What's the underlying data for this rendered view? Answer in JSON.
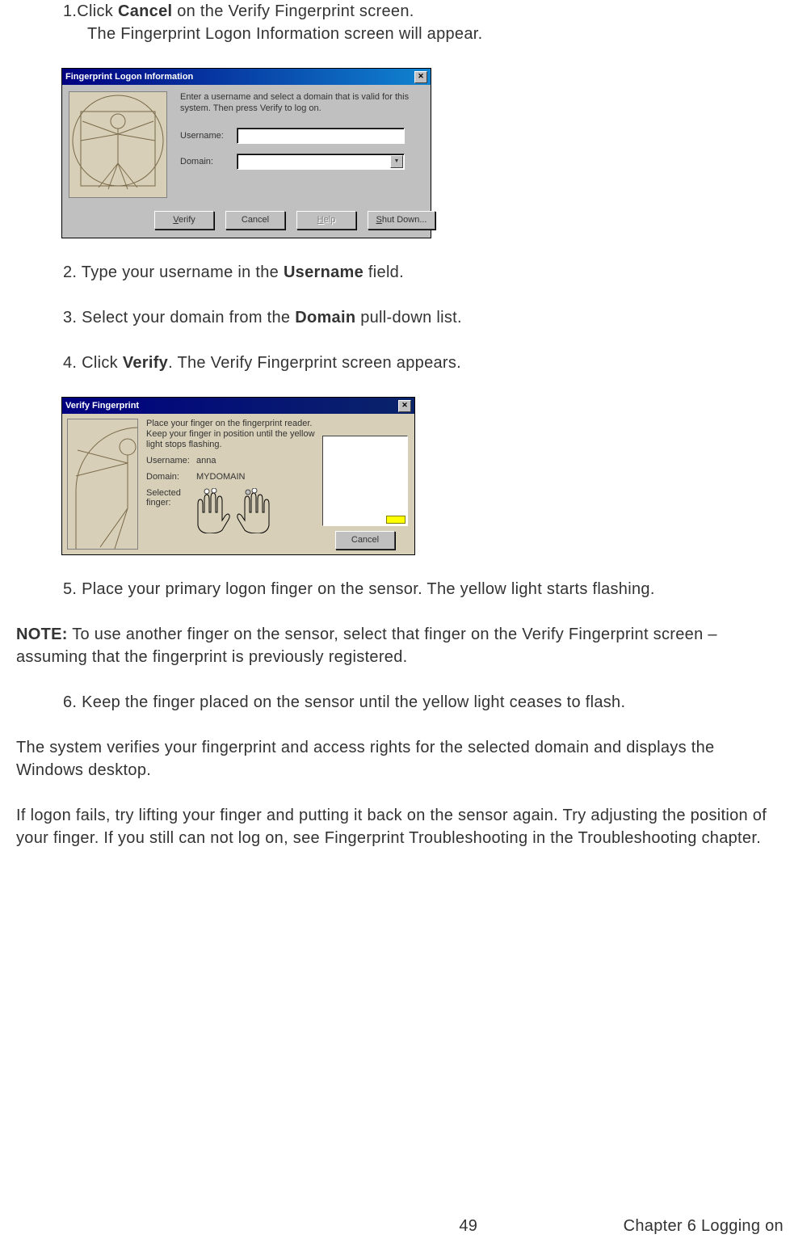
{
  "steps": {
    "s1_a": "1.",
    "s1_b": "Click ",
    "s1_c": "Cancel",
    "s1_d": " on the Verify Fingerprint screen.",
    "s1_e": "The Fingerprint Logon Information screen will appear.",
    "s2_a": "2. Type your username in the ",
    "s2_b": "Username",
    "s2_c": " field.",
    "s3_a": "3. Select your domain from the ",
    "s3_b": "Domain",
    "s3_c": " pull-down list.",
    "s4_a": "4. Click ",
    "s4_b": "Verify",
    "s4_c": ". The Verify Fingerprint screen appears.",
    "s5": "5. Place your primary logon finger on the sensor. The yellow light starts flashing.",
    "s6": "6. Keep the finger placed on the sensor until the yellow light ceases to flash."
  },
  "dlg1": {
    "title": "Fingerprint Logon Information",
    "instr": "Enter a username and select a domain that is valid for this system. Then press Verify to log on.",
    "username_label": "Username:",
    "domain_label": "Domain:",
    "verify_btn": "Verify",
    "verify_u": "V",
    "cancel_btn": "Cancel",
    "help_btn": "Help",
    "help_u": "H",
    "shutdown_a": "S",
    "shutdown_b": "hut Down..."
  },
  "dlg2": {
    "title": "Verify Fingerprint",
    "instr": "Place your finger on the fingerprint reader. Keep your finger in position until the yellow light stops flashing.",
    "username_label": "Username:",
    "username_val": "anna",
    "domain_label": "Domain:",
    "domain_val": "MYDOMAIN",
    "selected_label": "Selected finger:",
    "cancel_btn": "Cancel"
  },
  "note": {
    "label": "NOTE:",
    "text": " To use another finger on the sensor, select that finger on the Verify Fingerprint screen – assuming that the fingerprint is previously registered."
  },
  "para1": "The system verifies your fingerprint and access rights for the selected domain and displays the Windows desktop.",
  "para2": "If logon fails, try lifting your finger and putting it back on the sensor again. Try adjusting the position of your finger. If you still can not log on, see Fingerprint Troubleshooting in the Troubleshooting chapter.",
  "footer": {
    "page": "49",
    "chapter": "Chapter 6 Logging on"
  }
}
